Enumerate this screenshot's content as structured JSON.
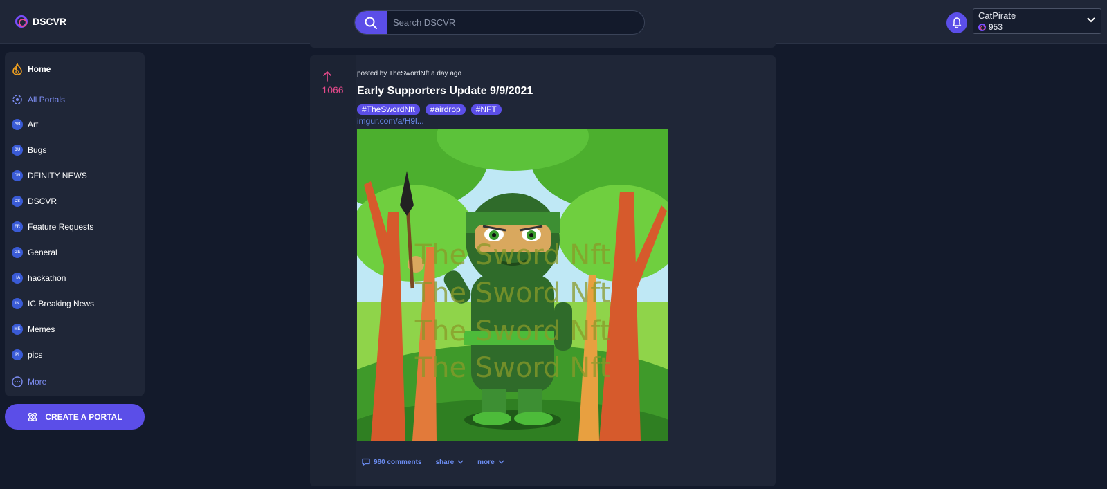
{
  "header": {
    "logo_text": "DSCVR",
    "search_placeholder": "Search DSCVR",
    "user": {
      "name": "CatPirate",
      "points": "953"
    }
  },
  "sidebar": {
    "home_label": "Home",
    "all_portals_label": "All Portals",
    "portals": [
      {
        "abbr": "AR",
        "label": "Art"
      },
      {
        "abbr": "BU",
        "label": "Bugs"
      },
      {
        "abbr": "DN",
        "label": "DFINITY NEWS"
      },
      {
        "abbr": "DS",
        "label": "DSCVR"
      },
      {
        "abbr": "FR",
        "label": "Feature Requests"
      },
      {
        "abbr": "GE",
        "label": "General"
      },
      {
        "abbr": "HA",
        "label": "hackathon"
      },
      {
        "abbr": "IN",
        "label": "IC Breaking News"
      },
      {
        "abbr": "ME",
        "label": "Memes"
      },
      {
        "abbr": "PI",
        "label": "pics"
      }
    ],
    "more_label": "More",
    "create_portal_label": "CREATE A PORTAL"
  },
  "post": {
    "votes": "1066",
    "meta": "posted by TheSwordNft a day ago",
    "title": "Early Supporters Update 9/9/2021",
    "tags": [
      "#TheSwordNft",
      "#airdrop",
      "#NFT"
    ],
    "link": "imgur.com/a/H9l...",
    "image_watermark": "The Sword Nft",
    "actions": {
      "comments": "980 comments",
      "share": "share",
      "more": "more"
    }
  },
  "colors": {
    "accent": "#5b4ee8",
    "vote": "#e84a8c",
    "link": "#6b8cf0",
    "background": "#131a2b",
    "panel": "#1f2637"
  },
  "icons": [
    "search-icon",
    "bell-icon",
    "chevron-down-icon",
    "home-icon",
    "portals-icon",
    "more-icon",
    "create-portal-icon",
    "upvote-icon",
    "comment-icon"
  ]
}
